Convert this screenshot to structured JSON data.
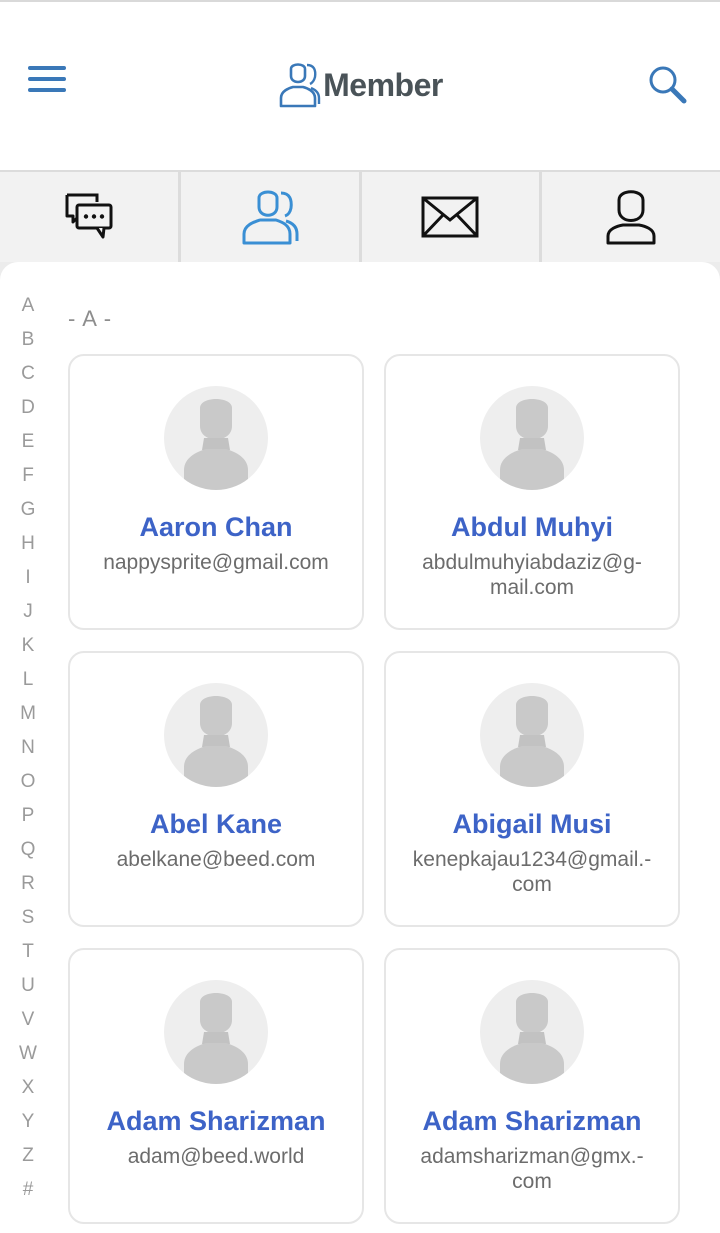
{
  "header": {
    "title": "Member",
    "menu_icon": "hamburger-menu-icon",
    "search_icon": "search-icon",
    "accent_color": "#3a78b8"
  },
  "tabs": [
    {
      "name": "chat",
      "icon": "chat-bubbles-icon",
      "active": false
    },
    {
      "name": "members",
      "icon": "members-icon",
      "active": true
    },
    {
      "name": "mail",
      "icon": "envelope-icon",
      "active": false
    },
    {
      "name": "profile",
      "icon": "user-icon",
      "active": false
    }
  ],
  "alphabet": [
    "A",
    "B",
    "C",
    "D",
    "E",
    "F",
    "G",
    "H",
    "I",
    "J",
    "K",
    "L",
    "M",
    "N",
    "O",
    "P",
    "Q",
    "R",
    "S",
    "T",
    "U",
    "V",
    "W",
    "X",
    "Y",
    "Z",
    "#"
  ],
  "section": {
    "label": "- A -"
  },
  "members": [
    {
      "name": "Aaron Chan",
      "email": "nappysprite@gmail.com"
    },
    {
      "name": "Abdul Muhyi",
      "email": "abdulmuhyiabdaziz@g-mail.com"
    },
    {
      "name": "Abel Kane",
      "email": "abelkane@beed.com"
    },
    {
      "name": "Abigail Musi",
      "email": "kenepkajau1234@gmail.-com"
    },
    {
      "name": "Adam Sharizman",
      "email": "adam@beed.world"
    },
    {
      "name": "Adam Sharizman",
      "email": "adamsharizman@gmx.-com"
    }
  ],
  "colors": {
    "name": "#3d63c7",
    "email": "#6c6c6c",
    "active_tab": "#3a8fd4"
  }
}
